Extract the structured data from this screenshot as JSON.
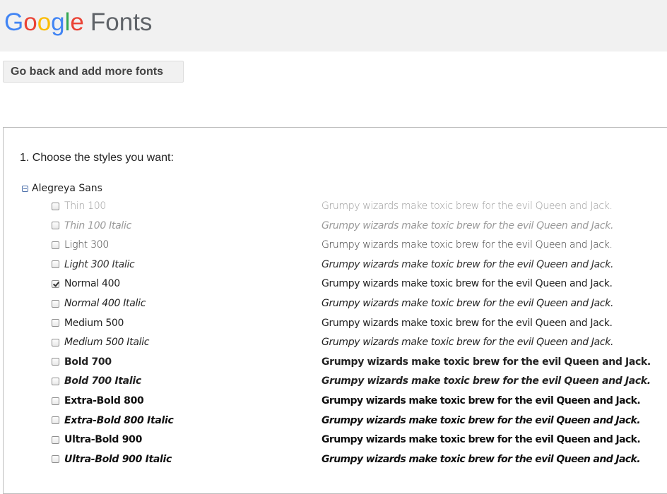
{
  "header": {
    "logo_word": "Google",
    "logo_suffix": "Fonts"
  },
  "back_button": {
    "label": "Go back and add more fonts"
  },
  "step1": {
    "title": "1. Choose the styles you want:"
  },
  "family": {
    "name": "Alegreya Sans",
    "styles": [
      {
        "label": "Thin 100",
        "weight": 100,
        "italic": false,
        "checked": false,
        "sample": "Grumpy wizards make toxic brew for the evil Queen and Jack."
      },
      {
        "label": "Thin 100 Italic",
        "weight": 100,
        "italic": true,
        "checked": false,
        "sample": "Grumpy wizards make toxic brew for the evil Queen and Jack."
      },
      {
        "label": "Light 300",
        "weight": 300,
        "italic": false,
        "checked": false,
        "sample": "Grumpy wizards make toxic brew for the evil Queen and Jack."
      },
      {
        "label": "Light 300 Italic",
        "weight": 300,
        "italic": true,
        "checked": false,
        "sample": "Grumpy wizards make toxic brew for the evil Queen and Jack."
      },
      {
        "label": "Normal 400",
        "weight": 400,
        "italic": false,
        "checked": true,
        "sample": "Grumpy wizards make toxic brew for the evil Queen and Jack."
      },
      {
        "label": "Normal 400 Italic",
        "weight": 400,
        "italic": true,
        "checked": false,
        "sample": "Grumpy wizards make toxic brew for the evil Queen and Jack."
      },
      {
        "label": "Medium 500",
        "weight": 500,
        "italic": false,
        "checked": false,
        "sample": "Grumpy wizards make toxic brew for the evil Queen and Jack."
      },
      {
        "label": "Medium 500 Italic",
        "weight": 500,
        "italic": true,
        "checked": false,
        "sample": "Grumpy wizards make toxic brew for the evil Queen and Jack."
      },
      {
        "label": "Bold 700",
        "weight": 700,
        "italic": false,
        "checked": false,
        "sample": "Grumpy wizards make toxic brew for the evil Queen and Jack."
      },
      {
        "label": "Bold 700 Italic",
        "weight": 700,
        "italic": true,
        "checked": false,
        "sample": "Grumpy wizards make toxic brew for the evil Queen and Jack."
      },
      {
        "label": "Extra-Bold 800",
        "weight": 800,
        "italic": false,
        "checked": false,
        "sample": "Grumpy wizards make toxic brew for the evil Queen and Jack."
      },
      {
        "label": "Extra-Bold 800 Italic",
        "weight": 800,
        "italic": true,
        "checked": false,
        "sample": "Grumpy wizards make toxic brew for the evil Queen and Jack."
      },
      {
        "label": "Ultra-Bold 900",
        "weight": 900,
        "italic": false,
        "checked": false,
        "sample": "Grumpy wizards make toxic brew for the evil Queen and Jack."
      },
      {
        "label": "Ultra-Bold 900 Italic",
        "weight": 900,
        "italic": true,
        "checked": false,
        "sample": "Grumpy wizards make toxic brew for the evil Queen and Jack."
      }
    ]
  },
  "colors": {
    "google_blue": "#4285F4",
    "google_red": "#EA4335",
    "google_yellow": "#FBBC05",
    "google_green": "#34A853",
    "header_bg": "#f1f1f1"
  }
}
